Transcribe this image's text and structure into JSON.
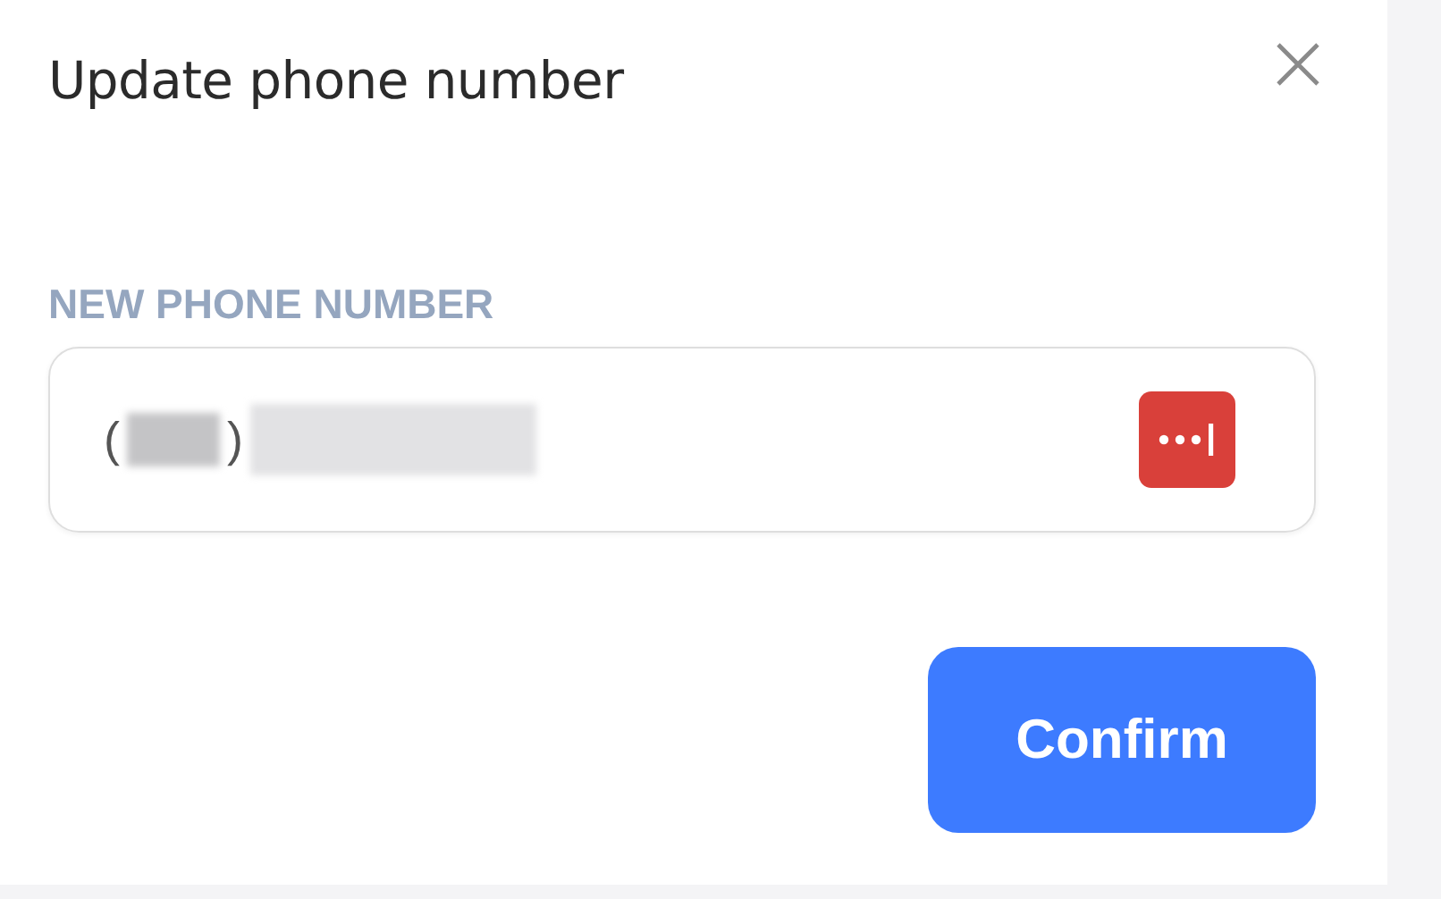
{
  "dialog": {
    "title": "Update phone number"
  },
  "field": {
    "label": "NEW PHONE NUMBER",
    "value_parts": [
      {
        "kind": "text",
        "text": "("
      },
      {
        "kind": "redacted"
      },
      {
        "kind": "text",
        "text": ")"
      },
      {
        "kind": "redacted"
      }
    ]
  },
  "buttons": [
    {
      "label": "Confirm"
    }
  ]
}
